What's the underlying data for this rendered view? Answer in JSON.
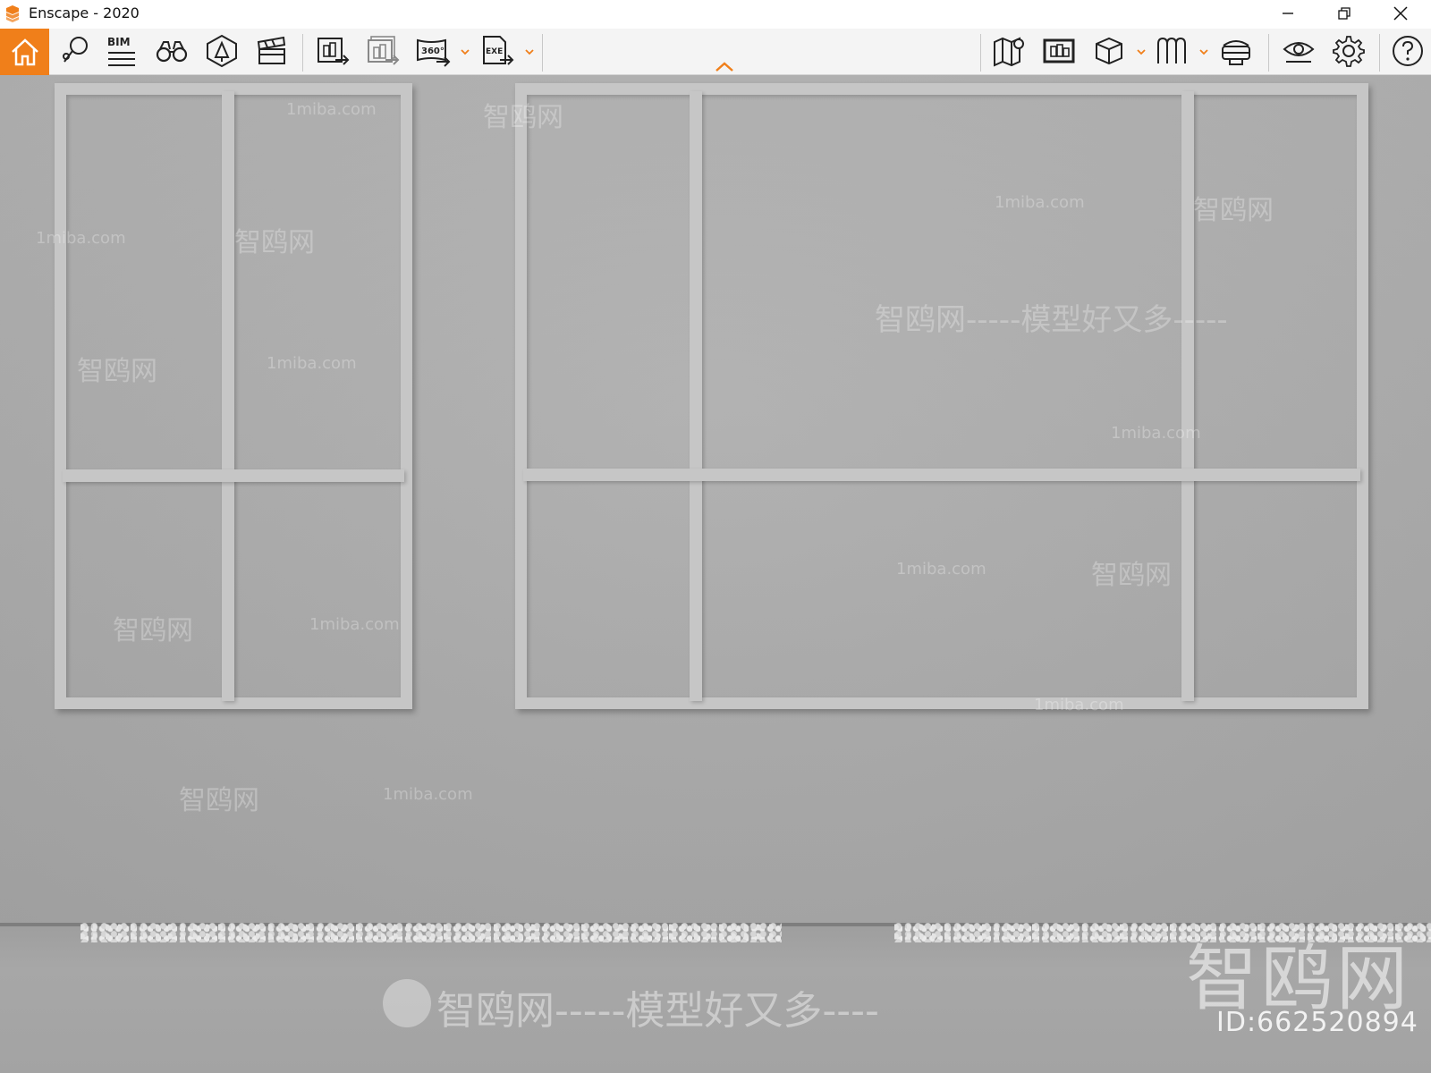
{
  "window": {
    "title": "Enscape - 2020"
  },
  "toolbar": {
    "bim_label": "BIM",
    "icons": [
      "home-icon",
      "views-icon",
      "bim-icon",
      "binoculars-icon",
      "assets-icon",
      "video-editor-icon",
      "screenshot-export-icon",
      "batch-render-icon",
      "panorama-360-icon",
      "exe-export-icon",
      "map-icon",
      "screen-icon",
      "cube-view-icon",
      "collaboration-icon",
      "vr-headset-icon",
      "visibility-icon",
      "settings-icon",
      "help-icon"
    ],
    "panorama_label": "360°",
    "exe_label": "EXE"
  },
  "watermarks": {
    "brand_large": "智鸥网",
    "id_text": "ID:662520894",
    "slogan": "智鸥网-----模型好又多----",
    "repeat": [
      "1miba.com",
      "智鸥网",
      "1miba.com",
      "智鸥网",
      "1miba.com",
      "智鸥网-----模型好又多-----",
      "智鸥网",
      "1miba.com",
      "智鸥网",
      "1miba.com",
      "1miba.com",
      "智鸥网",
      "智鸥网",
      "1miba.com",
      "1miba.com",
      "智鸥网",
      "1miba.com"
    ]
  },
  "colors": {
    "accent": "#f07f1a",
    "toolbar_bg": "#f4f4f4",
    "wall": "#a9a9a9",
    "moulding": "#c6c6c6"
  }
}
